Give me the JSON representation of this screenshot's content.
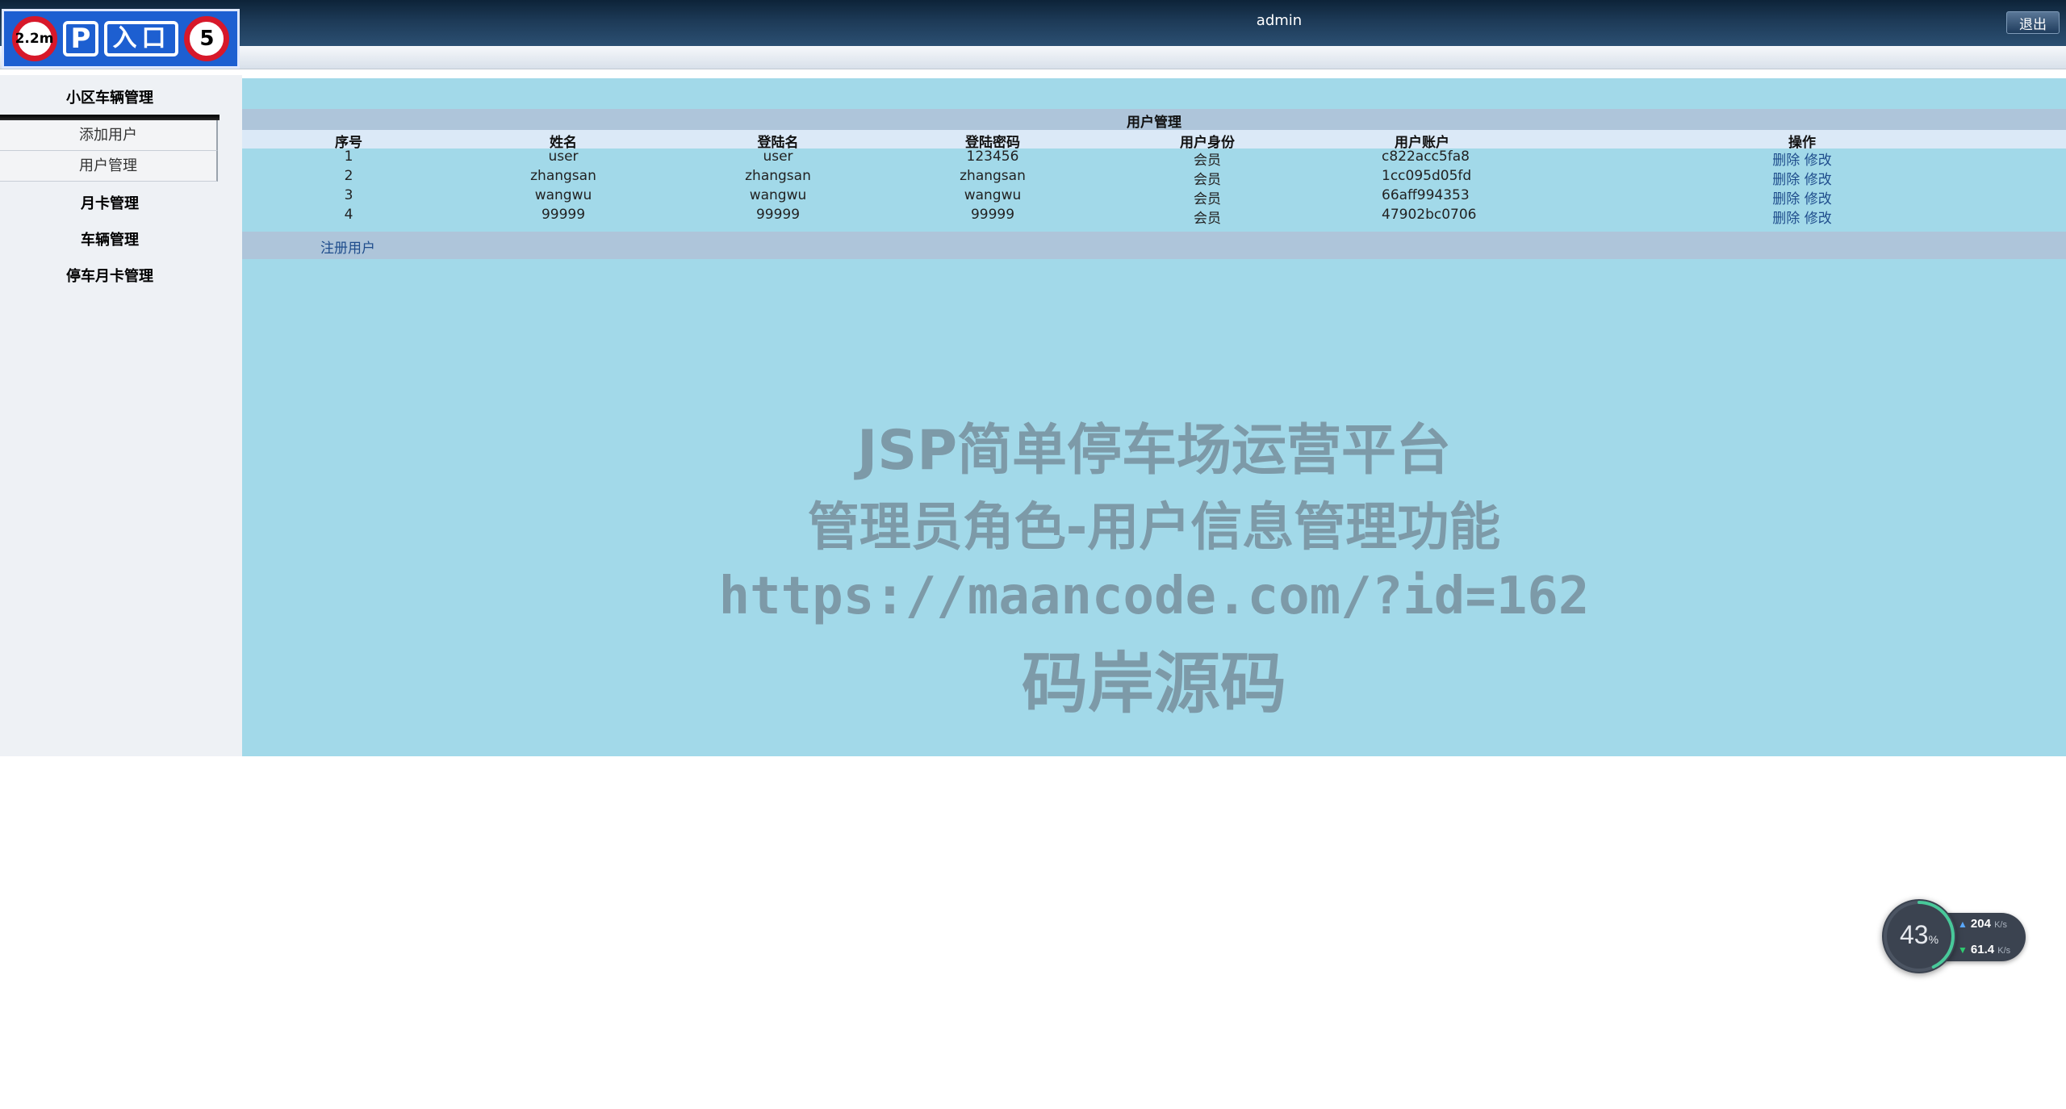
{
  "header": {
    "logo": [
      "2.2m",
      "P",
      "入口",
      "5"
    ],
    "user": "admin",
    "logout_label": "退出"
  },
  "sidebar": {
    "group1_title": "小区车辆管理",
    "group1_items": [
      "添加用户",
      "用户管理"
    ],
    "other_titles": [
      "月卡管理",
      "车辆管理",
      "停车月卡管理"
    ]
  },
  "main": {
    "panel_title": "用户管理",
    "columns": [
      "序号",
      "姓名",
      "登陆名",
      "登陆密码",
      "用户身份",
      "用户账户",
      "操作"
    ],
    "rows": [
      {
        "id": "1",
        "name": "user",
        "login": "user",
        "password": "123456",
        "role": "会员",
        "account": "c822acc5fa8",
        "delete": "删除",
        "edit": "修改"
      },
      {
        "id": "2",
        "name": "zhangsan",
        "login": "zhangsan",
        "password": "zhangsan",
        "role": "会员",
        "account": "1cc095d05fd",
        "delete": "删除",
        "edit": "修改"
      },
      {
        "id": "3",
        "name": "wangwu",
        "login": "wangwu",
        "password": "wangwu",
        "role": "会员",
        "account": "66aff994353",
        "delete": "删除",
        "edit": "修改"
      },
      {
        "id": "4",
        "name": "99999",
        "login": "99999",
        "password": "99999",
        "role": "会员",
        "account": "47902bc0706",
        "delete": "删除",
        "edit": "修改"
      }
    ],
    "register_label": "注册用户",
    "watermark": {
      "line1": "JSP简单停车场运营平台",
      "line2": "管理员角色-用户信息管理功能",
      "line3": "https://maancode.com/?id=162",
      "line4": "码岸源码"
    }
  },
  "speed_widget": {
    "percent": "43",
    "percent_unit": "%",
    "upload": "204",
    "download": "61.4",
    "unit": "K/s"
  },
  "colors": {
    "main_bg": "#a2d9e9",
    "header_bg": "#1d3a57",
    "row_bar": "#aec5da",
    "link": "#1f4d8c",
    "logo_bg": "#1d5fd1"
  }
}
